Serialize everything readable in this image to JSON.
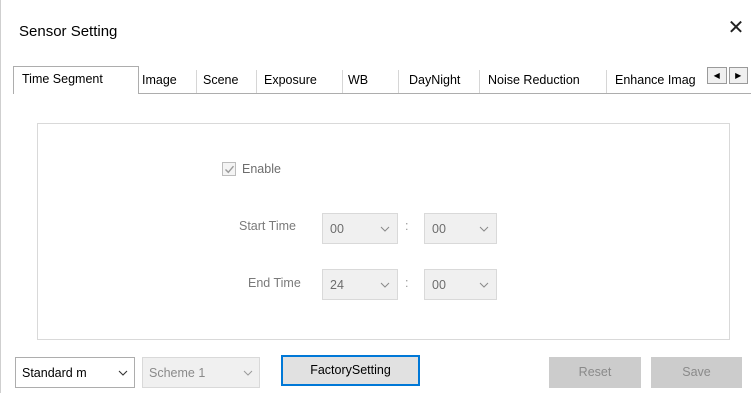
{
  "window": {
    "title": "Sensor Setting",
    "close_glyph": "✕"
  },
  "tabs": [
    {
      "label": "Time Segment",
      "active": true
    },
    {
      "label": "Image"
    },
    {
      "label": "Scene"
    },
    {
      "label": "Exposure"
    },
    {
      "label": "WB"
    },
    {
      "label": "DayNight"
    },
    {
      "label": "Noise Reduction"
    },
    {
      "label": "Enhance Imag"
    }
  ],
  "tab_scroll": {
    "left_glyph": "◀",
    "right_glyph": "▶"
  },
  "time_segment": {
    "enable_label": "Enable",
    "enable_checked": true,
    "start_time_label": "Start Time",
    "start_hour": "00",
    "start_minute": "00",
    "end_time_label": "End Time",
    "end_hour": "24",
    "end_minute": "00",
    "separator": ":"
  },
  "bottom": {
    "mode_value": "Standard m",
    "scheme_value": "Scheme 1",
    "factory_label": "FactorySetting",
    "reset_label": "Reset",
    "save_label": "Save"
  },
  "icons": {
    "close": "close-icon",
    "dropdown": "chevron-down-icon",
    "check": "checkmark-icon"
  },
  "colors": {
    "focus_border": "#0078d7",
    "disabled_bg": "#cccccc",
    "disabled_text": "#8a8a8a"
  }
}
